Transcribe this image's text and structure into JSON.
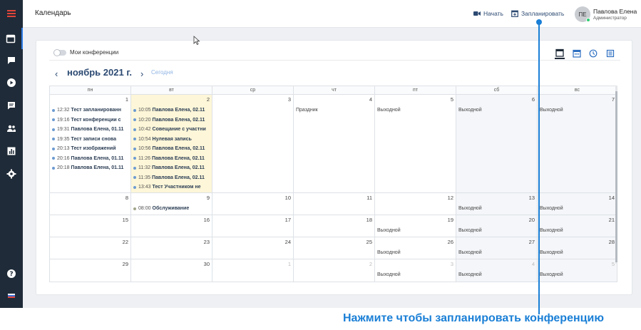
{
  "header": {
    "title": "Календарь",
    "start_label": "Начать",
    "schedule_label": "Запланировать",
    "user": {
      "initials": "ПЕ",
      "name": "Павлова Елена",
      "role": "Администратор"
    }
  },
  "sidebar": {
    "icons": [
      "menu-icon",
      "calendar-icon",
      "chat-icon",
      "play-icon",
      "messages-icon",
      "users-icon",
      "reports-icon",
      "settings-icon",
      "help-icon",
      "language-flag-icon"
    ]
  },
  "calendar": {
    "my_conferences_label": "Мои конференции",
    "month_title": "ноябрь 2021 г.",
    "today_label": "Сегодня",
    "weekdays": [
      "пн",
      "вт",
      "ср",
      "чт",
      "пт",
      "сб",
      "вс"
    ],
    "weeks": [
      [
        {
          "day": "1",
          "events": [
            {
              "time": "12:32",
              "name": "Тест запланированн"
            },
            {
              "time": "19:16",
              "name": "Тест конференции с"
            },
            {
              "time": "19:31",
              "name": "Павлова Елена, 01.11"
            },
            {
              "time": "19:35",
              "name": "Тест записи снова"
            },
            {
              "time": "20:13",
              "name": "Тест изображений"
            },
            {
              "time": "20:16",
              "name": "Павлова Елена, 01.11"
            },
            {
              "time": "20:18",
              "name": "Павлова Елена, 01.11"
            }
          ]
        },
        {
          "day": "2",
          "events": [
            {
              "time": "10:05",
              "name": "Павлова Елена, 02.11"
            },
            {
              "time": "10:20",
              "name": "Павлова Елена, 02.11"
            },
            {
              "time": "10:42",
              "name": "Совещание с участни"
            },
            {
              "time": "10:54",
              "name": "Нулевая запись"
            },
            {
              "time": "10:56",
              "name": "Павлова Елена, 02.11"
            },
            {
              "time": "11:26",
              "name": "Павлова Елена, 02.11"
            },
            {
              "time": "11:32",
              "name": "Павлова Елена, 02.11"
            },
            {
              "time": "11:35",
              "name": "Павлова Елена, 02.11"
            },
            {
              "time": "13:43",
              "name": "Тест Участником не"
            }
          ]
        },
        {
          "day": "3"
        },
        {
          "day": "4",
          "note": "Праздник"
        },
        {
          "day": "5",
          "note": "Выходной"
        },
        {
          "day": "6",
          "note": "Выходной"
        },
        {
          "day": "7",
          "note": "Выходной"
        }
      ],
      [
        {
          "day": "8"
        },
        {
          "day": "9",
          "events": [
            {
              "time": "08:00",
              "name": "Обслуживание",
              "color": "orange"
            }
          ]
        },
        {
          "day": "10"
        },
        {
          "day": "11"
        },
        {
          "day": "12"
        },
        {
          "day": "13",
          "note": "Выходной"
        },
        {
          "day": "14",
          "note": "Выходной"
        }
      ],
      [
        {
          "day": "15"
        },
        {
          "day": "16"
        },
        {
          "day": "17"
        },
        {
          "day": "18"
        },
        {
          "day": "19",
          "note": "Выходной"
        },
        {
          "day": "20",
          "note": "Выходной"
        },
        {
          "day": "21",
          "note": "Выходной"
        }
      ],
      [
        {
          "day": "22"
        },
        {
          "day": "23"
        },
        {
          "day": "24"
        },
        {
          "day": "25"
        },
        {
          "day": "26",
          "note": "Выходной"
        },
        {
          "day": "27",
          "note": "Выходной"
        },
        {
          "day": "28",
          "note": "Выходной"
        }
      ],
      [
        {
          "day": "29"
        },
        {
          "day": "30"
        },
        {
          "day": "1",
          "other": true
        },
        {
          "day": "2",
          "other": true
        },
        {
          "day": "3",
          "other": true,
          "note": "Выходной"
        },
        {
          "day": "4",
          "other": true,
          "note": "Выходной"
        },
        {
          "day": "5",
          "other": true,
          "note": "Выходной"
        }
      ]
    ]
  },
  "callout": {
    "text": "Нажмите чтобы запланировать конференцию"
  },
  "colors": {
    "sidebar": "#1f2b38",
    "accent": "#1a7fd6",
    "menu_icon": "#e0453a",
    "today": "#fdf6d8"
  }
}
